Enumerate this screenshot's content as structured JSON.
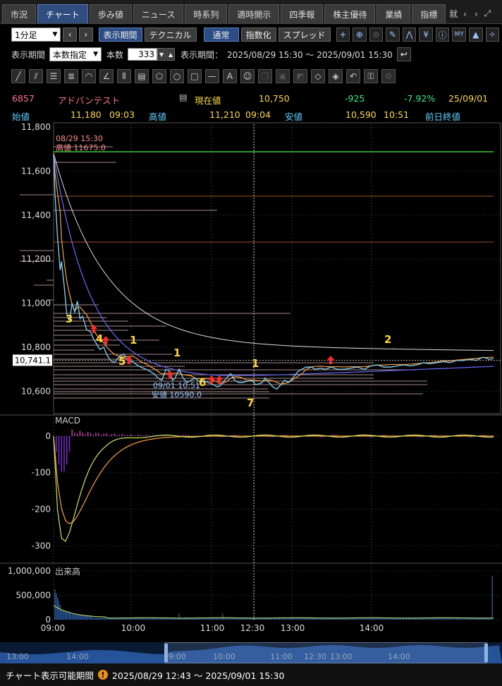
{
  "tabs": [
    {
      "label": "市況",
      "active": false
    },
    {
      "label": "チャート",
      "active": true
    },
    {
      "label": "歩み値",
      "active": false
    },
    {
      "label": "ニュース",
      "active": false
    },
    {
      "label": "時系列",
      "active": false
    },
    {
      "label": "適時開示",
      "active": false
    },
    {
      "label": "四季報",
      "active": false
    },
    {
      "label": "株主優待",
      "active": false
    },
    {
      "label": "業績",
      "active": false
    },
    {
      "label": "指標",
      "active": false
    }
  ],
  "tab_overflow": "就",
  "toolbar": {
    "interval": "1分足",
    "period_button": "表示期間",
    "technical_button": "テクニカル",
    "mode_normal": "通常",
    "mode_index": "指数化",
    "mode_spread": "スプレッド"
  },
  "period": {
    "label": "表示期間",
    "mode": "本数指定",
    "count_label": "本数",
    "count": "333",
    "range_label": "表示期間：",
    "range": "2025/08/29 15:30 〜 2025/09/01 15:30"
  },
  "quote": {
    "code": "6857",
    "name": "アドバンテスト",
    "current_label": "現在値",
    "current": "10,750",
    "change": "-925",
    "change_pct": "-7.92%",
    "date": "25/09/01",
    "open_label": "始値",
    "open": "11,180",
    "open_time": "09:03",
    "high_label": "高値",
    "high": "11,210",
    "high_time": "09:04",
    "low_label": "安値",
    "low": "10,590",
    "low_time": "10:51",
    "prev_close_label": "前日終値"
  },
  "chart_data": {
    "type": "line",
    "price_axis": {
      "ticks": [
        "11,800",
        "11,600",
        "11,400",
        "11,200",
        "11,000",
        "10,800",
        "10,600"
      ],
      "ylim": [
        10470,
        11800
      ]
    },
    "current_marker": "10,741.1",
    "time_axis": [
      "09:00",
      "10:00",
      "11:00",
      "12:30",
      "13:00",
      "14:00"
    ],
    "annotations": {
      "high_date": "08/29 15:30",
      "high_text": "高値 11675.0",
      "low_date": "09/01 10:51",
      "low_text": "安値 10590.0"
    },
    "wave_labels": [
      "3",
      "4",
      "5",
      "1",
      "1",
      "6",
      "1",
      "7",
      "2"
    ],
    "price_series": [
      [
        0,
        11675
      ],
      [
        1,
        11500
      ],
      [
        3,
        11300
      ],
      [
        5,
        11150
      ],
      [
        6,
        11190
      ],
      [
        8,
        11080
      ],
      [
        10,
        10950
      ],
      [
        12,
        10920
      ],
      [
        14,
        11000
      ],
      [
        16,
        10960
      ],
      [
        18,
        11010
      ],
      [
        20,
        10930
      ],
      [
        22,
        10940
      ],
      [
        25,
        10880
      ],
      [
        28,
        10870
      ],
      [
        30,
        10840
      ],
      [
        32,
        10820
      ],
      [
        35,
        10790
      ],
      [
        38,
        10800
      ],
      [
        40,
        10770
      ],
      [
        43,
        10740
      ],
      [
        46,
        10730
      ],
      [
        50,
        10760
      ],
      [
        53,
        10770
      ],
      [
        56,
        10740
      ],
      [
        60,
        10735
      ],
      [
        63,
        10720
      ],
      [
        66,
        10710
      ],
      [
        70,
        10700
      ],
      [
        73,
        10690
      ],
      [
        76,
        10680
      ],
      [
        79,
        10660
      ],
      [
        82,
        10650
      ],
      [
        85,
        10700
      ],
      [
        88,
        10690
      ],
      [
        90,
        10650
      ],
      [
        92,
        10660
      ],
      [
        95,
        10700
      ],
      [
        98,
        10660
      ],
      [
        101,
        10640
      ],
      [
        104,
        10650
      ],
      [
        107,
        10660
      ],
      [
        110,
        10645
      ],
      [
        113,
        10650
      ],
      [
        117,
        10640
      ],
      [
        121,
        10630
      ],
      [
        124,
        10620
      ],
      [
        126,
        10625
      ],
      [
        128,
        10640
      ],
      [
        131,
        10660
      ],
      [
        134,
        10680
      ],
      [
        137,
        10650
      ],
      [
        140,
        10640
      ],
      [
        143,
        10640
      ],
      [
        146,
        10645
      ],
      [
        150,
        10650
      ],
      [
        153,
        10630
      ],
      [
        156,
        10635
      ],
      [
        158,
        10640
      ],
      [
        160,
        10660
      ],
      [
        163,
        10640
      ],
      [
        166,
        10620
      ],
      [
        169,
        10610
      ],
      [
        172,
        10630
      ],
      [
        175,
        10650
      ],
      [
        178,
        10640
      ],
      [
        181,
        10660
      ],
      [
        185,
        10690
      ],
      [
        188,
        10700
      ],
      [
        191,
        10710
      ],
      [
        195,
        10710
      ],
      [
        198,
        10700
      ],
      [
        202,
        10705
      ],
      [
        206,
        10700
      ],
      [
        210,
        10710
      ],
      [
        215,
        10700
      ],
      [
        220,
        10700
      ],
      [
        225,
        10705
      ],
      [
        230,
        10710
      ],
      [
        235,
        10700
      ],
      [
        240,
        10715
      ],
      [
        245,
        10720
      ],
      [
        250,
        10710
      ],
      [
        255,
        10710
      ],
      [
        260,
        10715
      ],
      [
        265,
        10720
      ],
      [
        270,
        10715
      ],
      [
        275,
        10720
      ],
      [
        280,
        10730
      ],
      [
        285,
        10725
      ],
      [
        290,
        10730
      ],
      [
        295,
        10735
      ],
      [
        300,
        10730
      ],
      [
        305,
        10740
      ],
      [
        310,
        10740
      ],
      [
        315,
        10745
      ],
      [
        320,
        10740
      ],
      [
        325,
        10755
      ],
      [
        330,
        10745
      ],
      [
        333,
        10750
      ]
    ],
    "macd_axis": {
      "ticks": [
        "0",
        "-100",
        "-200",
        "-300"
      ],
      "ylim": [
        -340,
        50
      ]
    },
    "macd_label": "MACD",
    "volume_axis": {
      "ticks": [
        "1,000,000",
        "500,000",
        "0"
      ],
      "ylim": [
        0,
        1100000
      ]
    },
    "volume_label": "出来高",
    "overview_axis": [
      "13:00",
      "14:00",
      "09:00",
      "10:00",
      "11:00",
      "12:30",
      "13:00",
      "14:00"
    ]
  },
  "status": {
    "label": "チャート表示可能期間",
    "range": "2025/08/29 12:43 〜 2025/09/01 15:30"
  },
  "colors": {
    "accent": "#2f4d7f",
    "price": "#7fc8e8",
    "ma_fast": "#ffa040",
    "ma_mid": "#6a6aff",
    "ma_slow": "#dddddd",
    "hline_green": "#37c837",
    "hline_brown": "#a0522d",
    "arrow": "#ff2b2b",
    "wave_label": "#ffd53b"
  }
}
